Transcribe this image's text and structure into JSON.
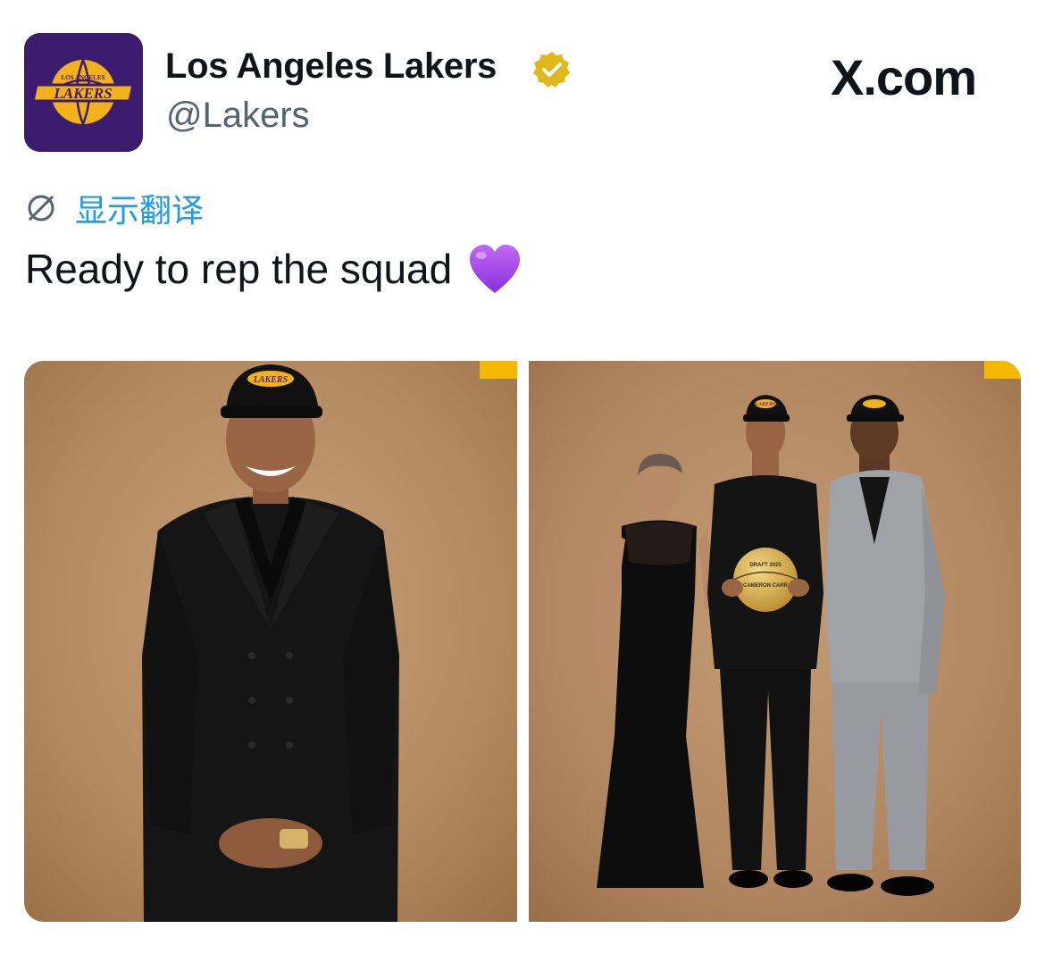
{
  "header": {
    "display_name": "Los Angeles Lakers",
    "handle": "@Lakers",
    "site_label": "X.com",
    "avatar_logo": {
      "top": "LOS ANGELES",
      "word": "LAKERS"
    },
    "verified_badge_color": "#e2b719"
  },
  "translate": {
    "label": "显示翻译",
    "icon": "translate-globe-icon",
    "color": "#1d9bf0"
  },
  "tweet": {
    "text": "Ready to rep the squad",
    "emoji": "purple-heart-icon"
  },
  "media": {
    "photos": [
      {
        "name": "photo-player-solo",
        "cap_text": "LAKERS"
      },
      {
        "name": "photo-player-family",
        "cap_text": "LAKERS",
        "ball_text": "CAMERON CARR",
        "ball_top": "DRAFT 2025"
      }
    ],
    "accent_color": "#f5b800",
    "brand_purple": "#552583"
  },
  "colors": {
    "text": "#0f1419",
    "secondary": "#536471",
    "backdrop": "#b58c62"
  }
}
